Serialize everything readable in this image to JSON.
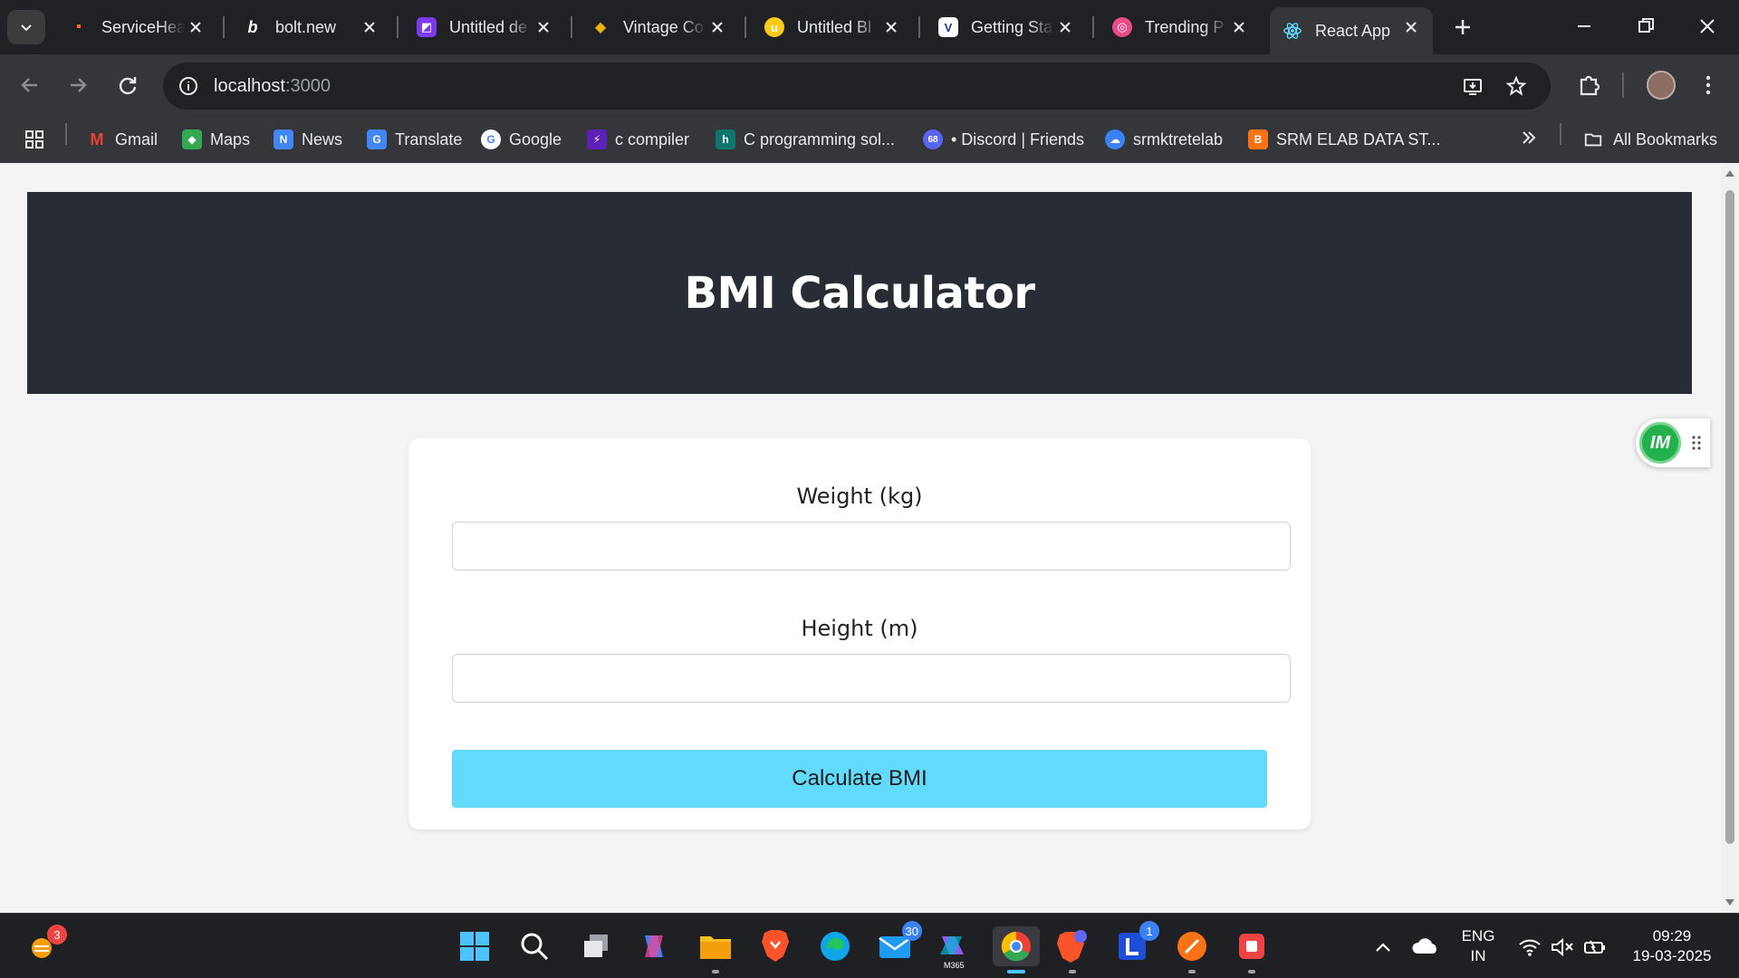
{
  "browser": {
    "tabs": [
      {
        "title": "ServiceHea",
        "favicon": "servicehealth-icon",
        "color": "#f97316"
      },
      {
        "title": "bolt.new",
        "favicon": "bolt-icon",
        "color": "#202124"
      },
      {
        "title": "Untitled de",
        "favicon": "design-icon",
        "color": "#7c3aed"
      },
      {
        "title": "Vintage Co",
        "favicon": "vintage-icon",
        "color": "#eab308"
      },
      {
        "title": "Untitled Bl",
        "favicon": "blog-icon",
        "color": "#facc15"
      },
      {
        "title": "Getting Sta",
        "favicon": "vuetify-icon",
        "color": "#1e3a8a"
      },
      {
        "title": "Trending P",
        "favicon": "dribbble-icon",
        "color": "#ea4c89"
      },
      {
        "title": "React App",
        "favicon": "react-icon",
        "color": "#61dafb",
        "active": true
      }
    ],
    "address": {
      "host": "localhost",
      "port": ":3000"
    },
    "bookmarks": [
      {
        "label": "Gmail",
        "icon": "gmail-icon",
        "color": "#ea4335",
        "glyph": "M"
      },
      {
        "label": "Maps",
        "icon": "maps-icon",
        "color": "#34a853",
        "glyph": "◆"
      },
      {
        "label": "News",
        "icon": "news-icon",
        "color": "#4285f4",
        "glyph": "N"
      },
      {
        "label": "Translate",
        "icon": "translate-icon",
        "color": "#4285f4",
        "glyph": "G"
      },
      {
        "label": "Google",
        "icon": "google-icon",
        "color": "#4285f4",
        "glyph": "G"
      },
      {
        "label": "c compiler",
        "icon": "compiler-icon",
        "color": "#5b21b6",
        "glyph": "⚡"
      },
      {
        "label": "C programming sol...",
        "icon": "c-programming-icon",
        "color": "#0f766e",
        "glyph": "h"
      },
      {
        "label": "• Discord | Friends",
        "icon": "discord-icon",
        "color": "#5865f2",
        "glyph": "68"
      },
      {
        "label": "srmktretelab",
        "icon": "cloud-icon",
        "color": "#3b82f6",
        "glyph": "☁"
      },
      {
        "label": "SRM ELAB DATA ST...",
        "icon": "blogger-icon",
        "color": "#f97316",
        "glyph": "B"
      }
    ],
    "all_bookmarks_label": "All Bookmarks"
  },
  "app": {
    "title": "BMI Calculator",
    "weight_label": "Weight (kg)",
    "weight_value": "",
    "height_label": "Height (m)",
    "height_value": "",
    "calculate_label": "Calculate BMI",
    "accent": "#61dafb",
    "header_bg": "#282c34"
  },
  "extension_badge": {
    "text": "IM",
    "color": "#22b14c"
  },
  "taskbar": {
    "weather_badge": "3",
    "mail_badge": "30",
    "m365_label": "M365",
    "todo_badge": "1",
    "language": "ENG",
    "region": "IN",
    "time": "09:29",
    "date": "19-03-2025"
  }
}
